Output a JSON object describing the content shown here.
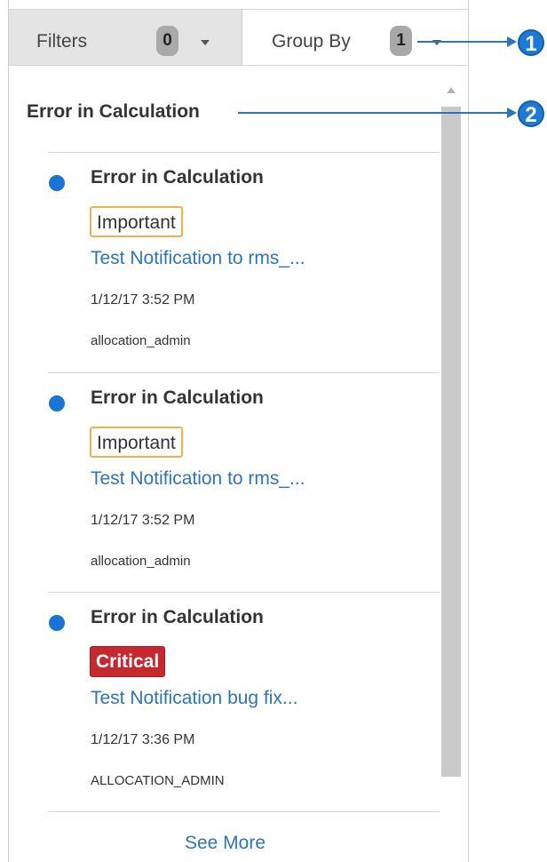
{
  "toolbar": {
    "filters_label": "Filters",
    "filters_count": "0",
    "group_by_label": "Group By",
    "group_by_count": "1"
  },
  "group": {
    "title": "Error in Calculation"
  },
  "notifications": [
    {
      "title": "Error in Calculation",
      "tag": "Important",
      "tag_type": "important",
      "link": "Test Notification to rms_...",
      "time": "1/12/17 3:52 PM",
      "user": "allocation_admin"
    },
    {
      "title": "Error in Calculation",
      "tag": "Important",
      "tag_type": "important",
      "link": "Test Notification to rms_...",
      "time": "1/12/17 3:52 PM",
      "user": "allocation_admin"
    },
    {
      "title": "Error in Calculation",
      "tag": "Critical",
      "tag_type": "critical",
      "link": "Test Notification bug fix...",
      "time": "1/12/17 3:36 PM",
      "user": "ALLOCATION_ADMIN"
    }
  ],
  "see_more": "See More",
  "callouts": [
    "1",
    "2"
  ],
  "colors": {
    "unread_dot": "#1a74d6",
    "link": "#2e74b8",
    "important_border": "#f1b24a",
    "critical_bg": "#c5282f",
    "callout": "#1f7ad6"
  },
  "icons": {
    "filters_dropdown": "chevron-down-icon",
    "group_by_dropdown": "chevron-down-icon",
    "unread": "dot-icon",
    "scroll_up": "arrow-up-icon"
  }
}
